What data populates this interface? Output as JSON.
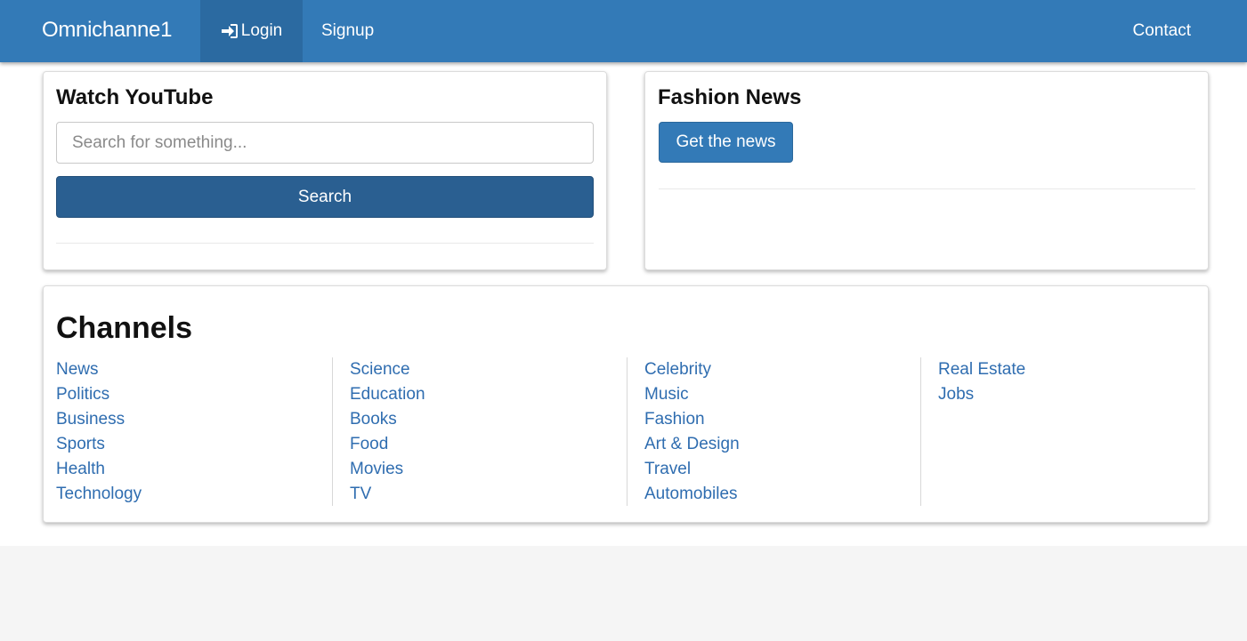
{
  "navbar": {
    "brand": "Omnichanne1",
    "login_label": "Login",
    "login_icon": "sign-in-icon",
    "signup_label": "Signup",
    "contact_label": "Contact"
  },
  "youtube": {
    "title": "Watch YouTube",
    "search_placeholder": "Search for something...",
    "search_value": "",
    "search_button": "Search"
  },
  "fashion": {
    "title": "Fashion News",
    "news_button": "Get the news"
  },
  "channels": {
    "title": "Channels",
    "columns": [
      [
        "News",
        "Politics",
        "Business",
        "Sports",
        "Health",
        "Technology"
      ],
      [
        "Science",
        "Education",
        "Books",
        "Food",
        "Movies",
        "TV"
      ],
      [
        "Celebrity",
        "Music",
        "Fashion",
        "Art & Design",
        "Travel",
        "Automobiles"
      ],
      [
        "Real Estate",
        "Jobs"
      ]
    ]
  },
  "colors": {
    "navbar": "#337ab7",
    "active_nav": "#2b6aa1",
    "search_button": "#2a5f91",
    "link": "#2f6db0"
  }
}
